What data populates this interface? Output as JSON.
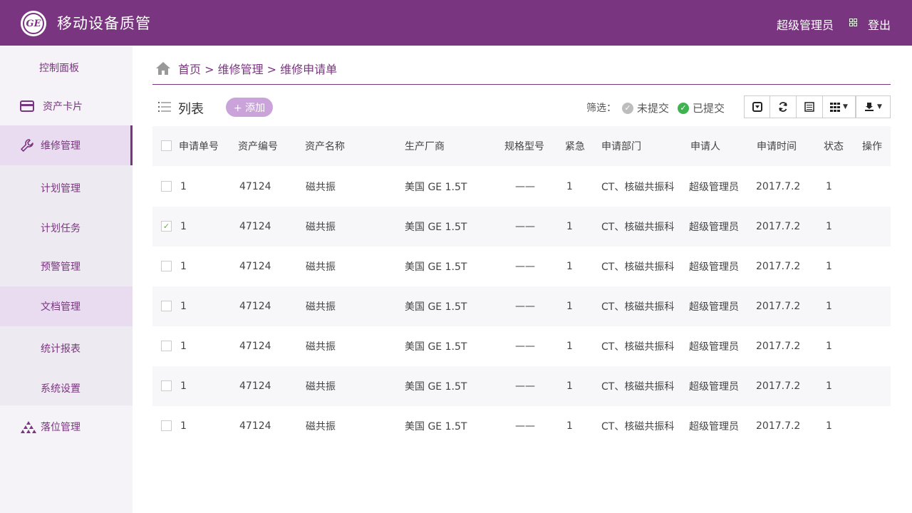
{
  "header": {
    "logo_text": "GE",
    "title": "移动设备质管",
    "user": "超级管理员",
    "logout": "登出"
  },
  "sidebar": {
    "items": [
      {
        "label": "控制面板"
      },
      {
        "label": "资产卡片"
      },
      {
        "label": "维修管理"
      },
      {
        "label": "计划管理"
      },
      {
        "label": "计划任务"
      },
      {
        "label": "预警管理"
      },
      {
        "label": "文档管理"
      },
      {
        "label": "统计报表"
      },
      {
        "label": "系统设置"
      },
      {
        "label": "落位管理"
      }
    ]
  },
  "breadcrumb": "首页 > 维修管理 > 维修申请单",
  "list": {
    "title": "列表",
    "add_label": "+ 添加"
  },
  "filter": {
    "label": "筛选：",
    "options": [
      "未提交",
      "已提交"
    ]
  },
  "colors": {
    "brand": "#7a3580",
    "accent_light": "#c9a3da",
    "ok": "#3fb34f",
    "muted": "#bdbdbd"
  },
  "table": {
    "headers": [
      "申请单号",
      "资产编号",
      "资产名称",
      "生产厂商",
      "规格型号",
      "紧急",
      "申请部门",
      "申请人",
      "申请时间",
      "状态",
      "操作"
    ],
    "rows": [
      [
        "1",
        "47124",
        "磁共振",
        "美国 GE  1.5T",
        "——",
        "1",
        "CT、核磁共振科",
        "超级管理员",
        "2017.7.2",
        "1"
      ],
      [
        "1",
        "47124",
        "磁共振",
        "美国 GE  1.5T",
        "——",
        "1",
        "CT、核磁共振科",
        "超级管理员",
        "2017.7.2",
        "1"
      ],
      [
        "1",
        "47124",
        "磁共振",
        "美国 GE  1.5T",
        "——",
        "1",
        "CT、核磁共振科",
        "超级管理员",
        "2017.7.2",
        "1"
      ],
      [
        "1",
        "47124",
        "磁共振",
        "美国 GE  1.5T",
        "——",
        "1",
        "CT、核磁共振科",
        "超级管理员",
        "2017.7.2",
        "1"
      ],
      [
        "1",
        "47124",
        "磁共振",
        "美国 GE  1.5T",
        "——",
        "1",
        "CT、核磁共振科",
        "超级管理员",
        "2017.7.2",
        "1"
      ],
      [
        "1",
        "47124",
        "磁共振",
        "美国 GE  1.5T",
        "——",
        "1",
        "CT、核磁共振科",
        "超级管理员",
        "2017.7.2",
        "1"
      ],
      [
        "1",
        "47124",
        "磁共振",
        "美国 GE  1.5T",
        "——",
        "1",
        "CT、核磁共振科",
        "超级管理员",
        "2017.7.2",
        "1"
      ]
    ],
    "checked": [
      false,
      true,
      false,
      false,
      false,
      false,
      false
    ]
  }
}
